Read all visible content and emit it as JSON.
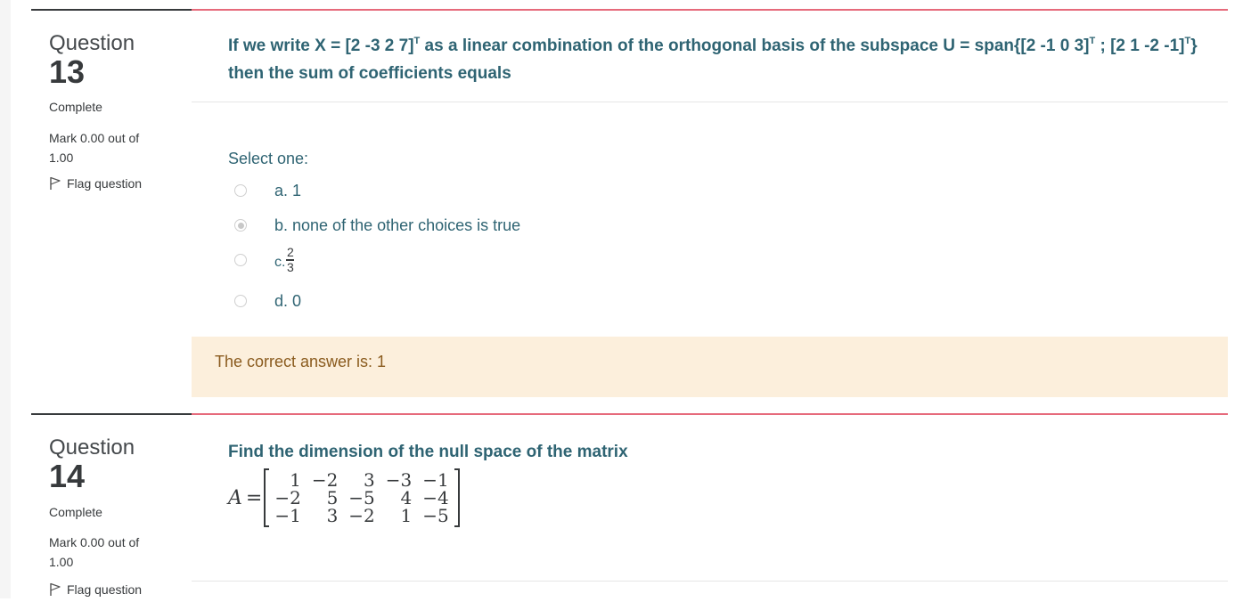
{
  "questions": [
    {
      "label": "Question",
      "number": "13",
      "state": "Complete",
      "grade": "Mark 0.00 out of 1.00",
      "flag_label": "Flag question",
      "text_part1": "If we write X = [2 -3 2 7]",
      "text_sup1": "T",
      "text_part2": " as a linear combination of the orthogonal basis of the subspace U = span{[2 -1 0 3]",
      "text_sup2": "T",
      "text_part3": " ; [2 1 -2 -1]",
      "text_sup3": "T",
      "text_part4": "} then the sum of coefficients equals",
      "prompt": "Select one:",
      "options": [
        {
          "label": "a. 1",
          "checked": false
        },
        {
          "label": "b. none of the other choices is true",
          "checked": true
        },
        {
          "prefix": "c.",
          "numerator": "2",
          "denominator": "3",
          "checked": false
        },
        {
          "label": "d. 0",
          "checked": false
        }
      ],
      "right_answer": "The correct answer is: 1"
    },
    {
      "label": "Question",
      "number": "14",
      "state": "Complete",
      "grade": "Mark 0.00 out of 1.00",
      "flag_label": "Flag question",
      "text": "Find the dimension of the null space of the matrix",
      "matrix_name": "A",
      "matrix_eq": "=",
      "matrix": [
        [
          "1",
          "−2",
          "3",
          "−3",
          "−1"
        ],
        [
          "−2",
          "5",
          "−5",
          "4",
          "−4"
        ],
        [
          "−1",
          "3",
          "−2",
          "1",
          "−5"
        ]
      ]
    }
  ],
  "colors": {
    "question_text": "#2f6473",
    "feedback_bg": "#fcefdc",
    "content_border": "#e66a7b"
  },
  "icons": {
    "flag": "flag-icon"
  }
}
